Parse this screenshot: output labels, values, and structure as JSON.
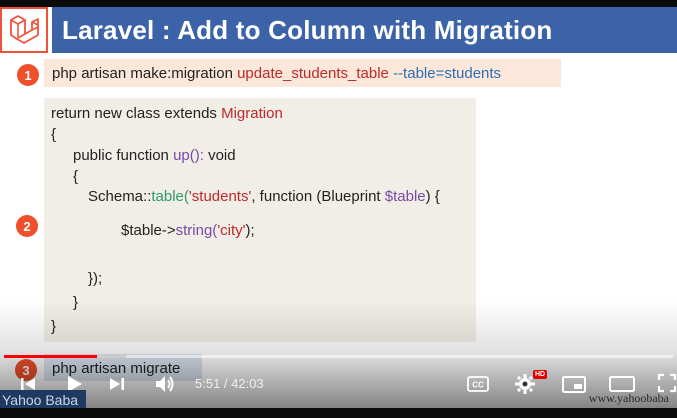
{
  "header": {
    "title": "Laravel : Add to Column with Migration",
    "logo_icon": "laravel-logo-icon"
  },
  "steps": {
    "one": "1",
    "two": "2",
    "three": "3"
  },
  "command1": {
    "prefix": "php artisan make:migration ",
    "name": "update_students_table",
    "option": "--table=students"
  },
  "code": {
    "line1_keyword": "return new class extends ",
    "line1_class": "Migration",
    "line2": "{",
    "line3_prefix": "public function ",
    "line3_method": "up():",
    "line3_suffix": " void",
    "line4": "{",
    "line5_schema": "Schema::",
    "line5_method": "table(",
    "line5_string": "'students'",
    "line5_rest": ", function (Blueprint ",
    "line5_var": "$table",
    "line5_end": ") {",
    "line6_var": "$table->",
    "line6_method": "string(",
    "line6_string": "'city'",
    "line6_end": ");",
    "line7": "});",
    "line8": "}",
    "line9": "}"
  },
  "command3": {
    "text": "php artisan migrate"
  },
  "player": {
    "time": "5:51 / 42:03",
    "played_fraction": 0.139,
    "loaded_fraction": 0.183,
    "hd_label": "HD",
    "controls": [
      "previous-icon",
      "play-icon",
      "next-icon",
      "volume-icon",
      "captions-icon",
      "settings-icon",
      "miniplayer-icon",
      "theater-icon",
      "fullscreen-icon"
    ]
  },
  "watermark": {
    "left": "Yahoo Baba",
    "right": "www.yahoobaba"
  },
  "colors": {
    "title_bar": "#3c63a8",
    "step_badge": "#ef4f2a",
    "laravel_red": "#f0533d",
    "progress_red": "#ff0000"
  }
}
